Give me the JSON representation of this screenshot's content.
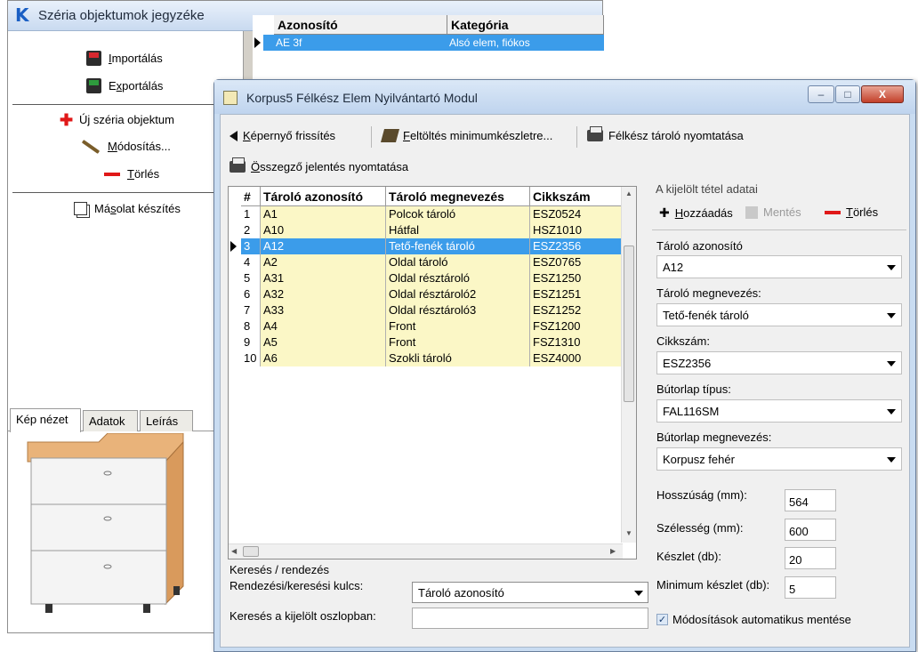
{
  "back_window": {
    "title": "Széria objektumok jegyzéke",
    "actions": {
      "import_pre": "I",
      "import_mid": "mportálás",
      "export_pre": "E",
      "export_u": "x",
      "export_post": "portálás",
      "new_label": "Új széria objektum",
      "modify_pre": "M",
      "modify_post": "ódosítás...",
      "delete_pre": "T",
      "delete_post": "örlés",
      "copy_pre": "Má",
      "copy_u": "s",
      "copy_post": "olat készítés"
    },
    "tabs": {
      "pic": "Kép nézet",
      "data": "Adatok",
      "desc": "Leírás"
    },
    "grid": {
      "col1": "Azonosító",
      "col2": "Kategória",
      "sel_id": "AE 3f",
      "sel_cat": "Alsó elem, fiókos"
    }
  },
  "front_window": {
    "title": "Korpus5 Félkész Elem Nyilvántartó Modul",
    "window_buttons": {
      "minimize": "–",
      "maximize": "□",
      "close": "X"
    },
    "toolbar": {
      "refresh_u": "K",
      "refresh": "épernyő frissítés",
      "fill_u": "F",
      "fill": "eltöltés minimumkészletre...",
      "print_store": "Félkész tároló nyomtatása",
      "print_summary_u": "Ö",
      "print_summary": "sszegző jelentés nyomtatása"
    },
    "grid": {
      "headers": [
        "#",
        "Tároló azonosító",
        "Tároló megnevezés",
        "Cikkszám"
      ],
      "rows": [
        [
          "1",
          "A1",
          "Polcok tároló",
          "ESZ0524"
        ],
        [
          "2",
          "A10",
          "Hátfal",
          "HSZ1010"
        ],
        [
          "3",
          "A12",
          "Tető-fenék tároló",
          "ESZ2356"
        ],
        [
          "4",
          "A2",
          "Oldal tároló",
          "ESZ0765"
        ],
        [
          "5",
          "A31",
          "Oldal résztároló",
          "ESZ1250"
        ],
        [
          "6",
          "A32",
          "Oldal résztároló2",
          "ESZ1251"
        ],
        [
          "7",
          "A33",
          "Oldal résztároló3",
          "ESZ1252"
        ],
        [
          "8",
          "A4",
          "Front",
          "FSZ1200"
        ],
        [
          "9",
          "A5",
          "Front",
          "FSZ1310"
        ],
        [
          "10",
          "A6",
          "Szokli tároló",
          "ESZ4000"
        ]
      ],
      "selected_index": 2
    },
    "search": {
      "group": "Keresés / rendezés",
      "key_label": "Rendezési/keresési kulcs:",
      "key_value": "Tároló azonosító",
      "col_label": "Keresés a kijelölt oszlopban:",
      "col_value": ""
    },
    "detail": {
      "group": "A kijelölt tétel adatai",
      "add_u": "H",
      "add": "ozzáadás",
      "save": "Mentés",
      "del_u": "T",
      "del": "örlés",
      "f1_label": "Tároló azonosító",
      "f1_value": "A12",
      "f2_label": "Tároló megnevezés:",
      "f2_value": "Tető-fenék tároló",
      "f3_label": "Cikkszám:",
      "f3_value": "ESZ2356",
      "f4_label": "Bútorlap típus:",
      "f4_value": "FAL116SM",
      "f5_label": "Bútorlap megnevezés:",
      "f5_value": "Korpusz fehér",
      "length_label": "Hosszúság (mm):",
      "length_value": "564",
      "width_label": "Szélesség (mm):",
      "width_value": "600",
      "stock_label": "Készlet (db):",
      "stock_value": "20",
      "min_label": "Minimum készlet (db):",
      "min_value": "5",
      "autosave": "Módosítások automatikus mentése",
      "autosave_checked": "✓"
    }
  }
}
